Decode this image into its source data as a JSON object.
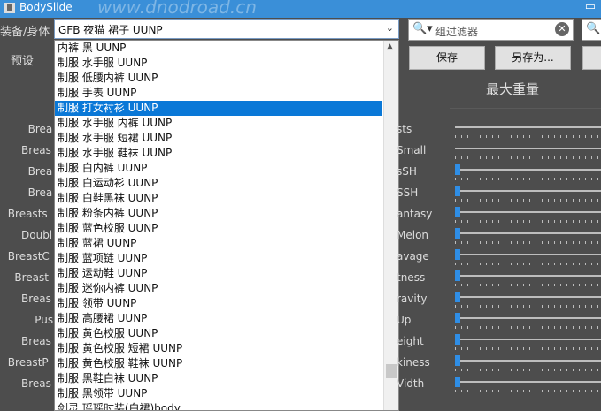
{
  "window": {
    "title": "BodySlide",
    "watermark": "www.dnodroad.cn"
  },
  "left_labels": {
    "outfit": "装备/身体",
    "preset": "预设",
    "sliders_partial": [
      "Brea",
      "Breas",
      "Brea",
      "Brea",
      "Breasts",
      "Doubl",
      "BreastC",
      "Breast",
      "Breas",
      "Pus",
      "Breas",
      "BreastP",
      "Breas"
    ]
  },
  "outfit_combo": {
    "value": "GFB 夜猫 裙子 UUNP"
  },
  "dropdown": {
    "selected_index": 4,
    "items": [
      "内裤 黑 UUNP",
      "制服 水手服 UUNP",
      "制服 低腰内裤 UUNP",
      "制服 手表 UUNP",
      "制服 打女衬衫 UUNP",
      "制服 水手服 内裤 UUNP",
      "制服 水手服 短裙 UUNP",
      "制服 水手服 鞋袜 UUNP",
      "制服 白内裤 UUNP",
      "制服 白运动衫 UUNP",
      "制服 白鞋黑袜 UUNP",
      "制服 粉条内裤 UUNP",
      "制服 蓝色校服 UUNP",
      "制服 蓝裙 UUNP",
      "制服 蓝项链 UUNP",
      "制服 运动鞋 UUNP",
      "制服 迷你内裤 UUNP",
      "制服 领带 UUNP",
      "制服 高腰裙 UUNP",
      "制服 黄色校服 UUNP",
      "制服 黄色校服 短裙 UUNP",
      "制服 黄色校服 鞋袜 UUNP",
      "制服 黑鞋白袜 UUNP",
      "制服 黑领带 UUNP",
      "剑灵 瑶瑶时装(白裙)body"
    ]
  },
  "group_filter": {
    "placeholder": "组过滤器"
  },
  "buttons": {
    "save": "保存",
    "save_as": "另存为..."
  },
  "section": {
    "title": "最大重量"
  },
  "slider_rows": [
    {
      "label": "sts",
      "value": null
    },
    {
      "label": "Small",
      "value": null
    },
    {
      "label": "sSH",
      "value": 0
    },
    {
      "label": "SSH",
      "value": 0
    },
    {
      "label": "antasy",
      "value": 0
    },
    {
      "label": "Melon",
      "value": 0
    },
    {
      "label": "avage",
      "value": 0
    },
    {
      "label": "tness",
      "value": 0
    },
    {
      "label": "ravity",
      "value": 0
    },
    {
      "label": "Up",
      "value": 0
    },
    {
      "label": "eight",
      "value": 0
    },
    {
      "label": "kiness",
      "value": 0
    },
    {
      "label": "Vidth",
      "value": 0
    }
  ],
  "colors": {
    "background": "#4d4d4d",
    "titlebar": "#3a8fd8",
    "selection": "#0a78d7",
    "slider_handle": "#2f8ee6"
  }
}
